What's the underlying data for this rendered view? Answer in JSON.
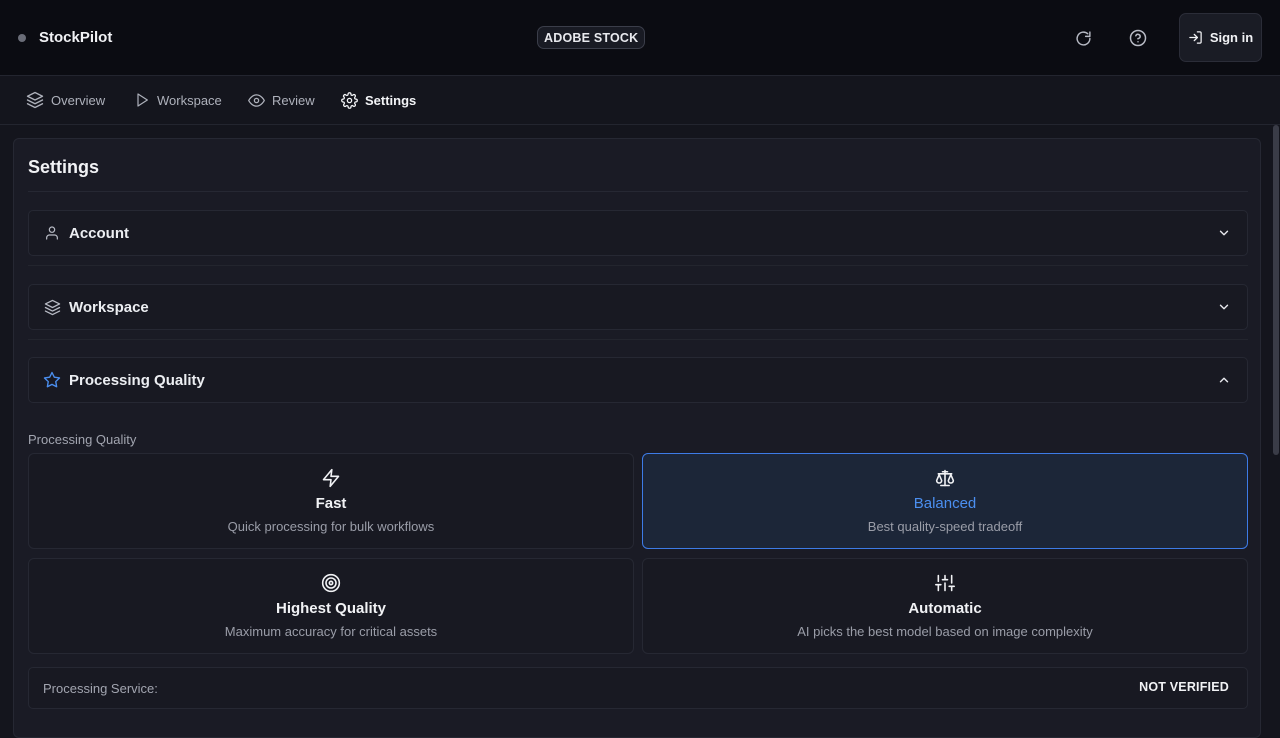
{
  "app": {
    "name": "StockPilot",
    "platform_badge": "ADOBE STOCK"
  },
  "header": {
    "refresh_icon": "refresh-icon",
    "help_icon": "help-icon",
    "signin_label": "Sign in"
  },
  "nav": {
    "tabs": [
      {
        "label": "Overview",
        "icon": "layers-icon"
      },
      {
        "label": "Workspace",
        "icon": "play-icon"
      },
      {
        "label": "Review",
        "icon": "eye-icon"
      },
      {
        "label": "Settings",
        "icon": "gear-icon",
        "active": true
      }
    ]
  },
  "settings": {
    "title": "Settings",
    "sections": [
      {
        "label": "Account",
        "icon": "user-icon",
        "expanded": false
      },
      {
        "label": "Workspace",
        "icon": "layers-icon",
        "expanded": false
      },
      {
        "label": "Processing Quality",
        "icon": "star-icon",
        "expanded": true
      }
    ],
    "quality": {
      "group_label": "Processing Quality",
      "options": [
        {
          "title": "Fast",
          "desc": "Quick processing for bulk workflows",
          "icon": "zap-icon"
        },
        {
          "title": "Balanced",
          "desc": "Best quality-speed tradeoff",
          "icon": "scale-icon",
          "selected": true
        },
        {
          "title": "Highest Quality",
          "desc": "Maximum accuracy for critical assets",
          "icon": "target-icon"
        },
        {
          "title": "Automatic",
          "desc": "AI picks the best model based on image complexity",
          "icon": "sliders-icon"
        }
      ]
    },
    "service": {
      "label": "Processing Service:",
      "status": "NOT VERIFIED"
    }
  },
  "colors": {
    "accent": "#4b8ff0",
    "selected_border": "#3d7be6",
    "background": "#14151d"
  }
}
